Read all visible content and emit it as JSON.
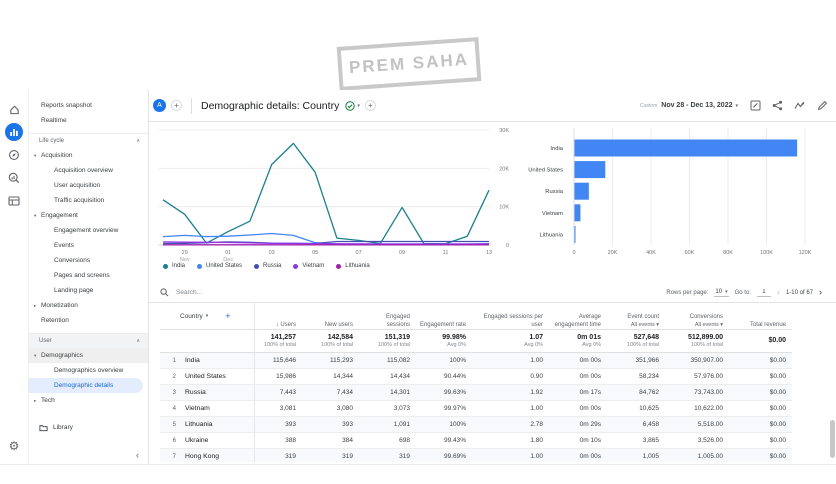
{
  "watermark": "PREM SAHA",
  "colors": {
    "accent": "#1a73e8",
    "bar": "#4285f4",
    "selected_bg": "#e3edfd",
    "grid": "#ececec"
  },
  "rail": {
    "items": [
      {
        "icon": "home-icon"
      },
      {
        "icon": "reports-icon",
        "selected": true
      },
      {
        "icon": "explore-icon"
      },
      {
        "icon": "advertising-icon"
      },
      {
        "icon": "configure-icon"
      }
    ],
    "bottom_icon": "admin-gear-icon",
    "gear_glyph": "⚙"
  },
  "sidebar": {
    "items": [
      {
        "label": "Reports snapshot",
        "type": "item"
      },
      {
        "label": "Realtime",
        "type": "item"
      },
      {
        "label": "Life cycle",
        "type": "section",
        "caret": "∧"
      },
      {
        "label": "Acquisition",
        "type": "parent",
        "state": "expanded"
      },
      {
        "label": "Acquisition overview",
        "type": "child"
      },
      {
        "label": "User acquisition",
        "type": "child"
      },
      {
        "label": "Traffic acquisition",
        "type": "child"
      },
      {
        "label": "Engagement",
        "type": "parent",
        "state": "expanded"
      },
      {
        "label": "Engagement overview",
        "type": "child"
      },
      {
        "label": "Events",
        "type": "child"
      },
      {
        "label": "Conversions",
        "type": "child"
      },
      {
        "label": "Pages and screens",
        "type": "child"
      },
      {
        "label": "Landing page",
        "type": "child"
      },
      {
        "label": "Monetization",
        "type": "parent",
        "state": "collapsed"
      },
      {
        "label": "Retention",
        "type": "item"
      },
      {
        "label": "User",
        "type": "section",
        "caret": "∧",
        "highlighted": true
      },
      {
        "label": "Demographics",
        "type": "parent",
        "state": "expanded",
        "highlighted": true
      },
      {
        "label": "Demographics overview",
        "type": "child"
      },
      {
        "label": "Demographic details",
        "type": "child",
        "selected": true
      },
      {
        "label": "Tech",
        "type": "parent",
        "state": "collapsed"
      },
      {
        "label": "Library",
        "type": "library"
      }
    ],
    "collapse_glyph": "‹"
  },
  "header": {
    "avatar": "A",
    "add_comparison": "+",
    "title": "Demographic details: Country",
    "add_metric": "+",
    "date_preset": "Custom",
    "date_range": "Nov 28 - Dec 13, 2022",
    "caret": "▾"
  },
  "chart_data": [
    {
      "type": "line",
      "title": "Users by Country over time",
      "x": [
        "Nov 28",
        "Nov 29",
        "Nov 30",
        "Dec 01",
        "Dec 02",
        "Dec 03",
        "Dec 04",
        "Dec 05",
        "Dec 06",
        "Dec 07",
        "Dec 08",
        "Dec 09",
        "Dec 10",
        "Dec 11",
        "Dec 12",
        "Dec 13"
      ],
      "tick_labels": [
        {
          "index": 1,
          "line1": "29",
          "line2": "Nov"
        },
        {
          "index": 3,
          "line1": "01",
          "line2": "Dec"
        },
        {
          "index": 5,
          "line1": "03",
          "line2": ""
        },
        {
          "index": 7,
          "line1": "05",
          "line2": ""
        },
        {
          "index": 9,
          "line1": "07",
          "line2": ""
        },
        {
          "index": 11,
          "line1": "09",
          "line2": ""
        },
        {
          "index": 13,
          "line1": "11",
          "line2": ""
        },
        {
          "index": 15,
          "line1": "13",
          "line2": ""
        }
      ],
      "ylim": [
        0,
        30000
      ],
      "yticks": [
        {
          "v": 0,
          "label": "0"
        },
        {
          "v": 10000,
          "label": "10K"
        },
        {
          "v": 20000,
          "label": "20K"
        },
        {
          "v": 30000,
          "label": "30K"
        }
      ],
      "grid": true,
      "legend_position": "bottom",
      "series": [
        {
          "name": "India",
          "color": "#1b7f8e",
          "values": [
            11800,
            8000,
            500,
            3500,
            6200,
            21000,
            26500,
            19000,
            1800,
            1200,
            400,
            9800,
            400,
            300,
            2300,
            14300
          ]
        },
        {
          "name": "United States",
          "color": "#4285f4",
          "values": [
            2200,
            2500,
            2200,
            2300,
            2600,
            3000,
            2500,
            600,
            250,
            250,
            250,
            250,
            250,
            250,
            250,
            300
          ]
        },
        {
          "name": "Russia",
          "color": "#3f51b5",
          "values": [
            400,
            450,
            600,
            800,
            700,
            500,
            450,
            400,
            900,
            900,
            900,
            900,
            900,
            900,
            900,
            900
          ]
        },
        {
          "name": "Vietnam",
          "color": "#9334e6",
          "values": [
            800,
            750,
            700,
            650,
            550,
            450,
            400,
            350,
            300,
            280,
            260,
            260,
            260,
            260,
            260,
            280
          ]
        },
        {
          "name": "Lithuania",
          "color": "#a121af",
          "values": [
            60,
            60,
            60,
            60,
            60,
            60,
            60,
            60,
            60,
            60,
            60,
            60,
            60,
            60,
            60,
            60
          ]
        }
      ]
    },
    {
      "type": "bar",
      "orientation": "horizontal",
      "title": "Users by Country",
      "categories": [
        "India",
        "United States",
        "Russia",
        "Vietnam",
        "Lithuania"
      ],
      "values": [
        115646,
        15986,
        7443,
        3081,
        393
      ],
      "color": "#4285f4",
      "xlim": [
        0,
        120000
      ],
      "xticks": [
        "0",
        "20K",
        "40K",
        "60K",
        "80K",
        "100K",
        "120K"
      ],
      "grid": true
    }
  ],
  "table": {
    "search_placeholder": "Search...",
    "search_icon": "search-icon",
    "pagination": {
      "rows_per_page_label": "Rows per page:",
      "rows_per_page": "10",
      "goto_label": "Go to:",
      "goto_value": "1",
      "prev_glyph": "‹",
      "range": "1-10 of 67",
      "next_glyph": "›"
    },
    "dimension_column": {
      "label": "Country",
      "caret": "▾",
      "add": "+"
    },
    "columns": [
      {
        "label": "Users",
        "sorted": "↓"
      },
      {
        "label": "New users"
      },
      {
        "label": "Engaged sessions"
      },
      {
        "label": "Engagement rate"
      },
      {
        "label": "Engaged sessions per user"
      },
      {
        "label": "Average engagement time"
      },
      {
        "label": "Event count",
        "sub": "All events ▾"
      },
      {
        "label": "Conversions",
        "sub": "All events ▾"
      },
      {
        "label": "Total revenue"
      }
    ],
    "totals": {
      "values": [
        "141,257",
        "142,584",
        "151,319",
        "99.98%",
        "1.07",
        "0m 01s",
        "527,648",
        "512,899.00",
        "$0.00"
      ],
      "subs": [
        "100% of total",
        "100% of total",
        "100% of total",
        "Avg 0%",
        "Avg 0%",
        "Avg 0%",
        "100% of total",
        "100% of total",
        ""
      ]
    },
    "rows": [
      {
        "n": "1",
        "country": "India",
        "values": [
          "115,646",
          "115,293",
          "115,082",
          "100%",
          "1.00",
          "0m 00s",
          "351,966",
          "350,907.00",
          "$0.00"
        ]
      },
      {
        "n": "2",
        "country": "United States",
        "values": [
          "15,986",
          "14,344",
          "14,434",
          "90.44%",
          "0.90",
          "0m 00s",
          "58,234",
          "57,976.00",
          "$0.00"
        ]
      },
      {
        "n": "3",
        "country": "Russia",
        "values": [
          "7,443",
          "7,434",
          "14,301",
          "99.63%",
          "1.92",
          "0m 17s",
          "84,762",
          "73,743.00",
          "$0.00"
        ]
      },
      {
        "n": "4",
        "country": "Vietnam",
        "values": [
          "3,081",
          "3,080",
          "3,073",
          "99.97%",
          "1.00",
          "0m 00s",
          "10,625",
          "10,622.00",
          "$0.00"
        ]
      },
      {
        "n": "5",
        "country": "Lithuania",
        "values": [
          "393",
          "393",
          "1,091",
          "100%",
          "2.78",
          "0m 29s",
          "6,458",
          "5,518.00",
          "$0.00"
        ]
      },
      {
        "n": "6",
        "country": "Ukraine",
        "values": [
          "388",
          "384",
          "698",
          "99.43%",
          "1.80",
          "0m 10s",
          "3,865",
          "3,526.00",
          "$0.00"
        ]
      },
      {
        "n": "7",
        "country": "Hong Kong",
        "values": [
          "319",
          "319",
          "319",
          "99.69%",
          "1.00",
          "0m 00s",
          "1,005",
          "1,005.00",
          "$0.00"
        ]
      }
    ]
  }
}
